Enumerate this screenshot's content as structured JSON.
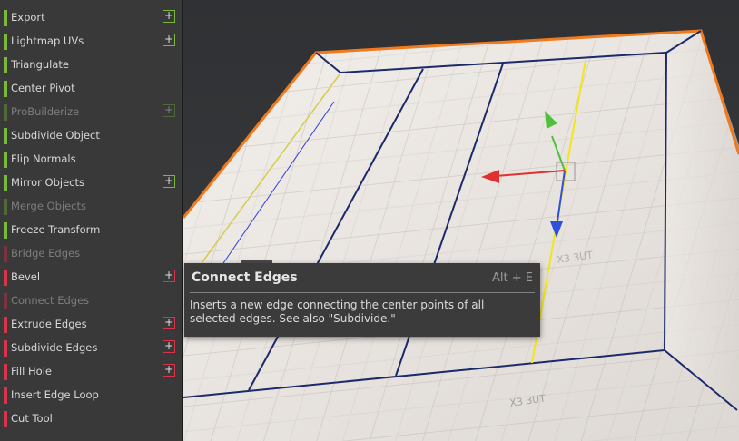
{
  "menu": {
    "items": [
      {
        "label": "Export",
        "category": "object",
        "enabled": true,
        "has_options": true
      },
      {
        "label": "Lightmap UVs",
        "category": "object",
        "enabled": true,
        "has_options": true
      },
      {
        "label": "Triangulate",
        "category": "object",
        "enabled": true,
        "has_options": false
      },
      {
        "label": "Center Pivot",
        "category": "object",
        "enabled": true,
        "has_options": false
      },
      {
        "label": "ProBuilderize",
        "category": "object",
        "enabled": false,
        "has_options": true
      },
      {
        "label": "Subdivide Object",
        "category": "object",
        "enabled": true,
        "has_options": false
      },
      {
        "label": "Flip Normals",
        "category": "object",
        "enabled": true,
        "has_options": false
      },
      {
        "label": "Mirror Objects",
        "category": "object",
        "enabled": true,
        "has_options": true
      },
      {
        "label": "Merge Objects",
        "category": "object",
        "enabled": false,
        "has_options": false
      },
      {
        "label": "Freeze Transform",
        "category": "object",
        "enabled": true,
        "has_options": false
      },
      {
        "label": "Bridge Edges",
        "category": "edge",
        "enabled": false,
        "has_options": false
      },
      {
        "label": "Bevel",
        "category": "edge",
        "enabled": true,
        "has_options": true
      },
      {
        "label": "Connect Edges",
        "category": "edge",
        "enabled": false,
        "has_options": false
      },
      {
        "label": "Extrude Edges",
        "category": "edge",
        "enabled": true,
        "has_options": true
      },
      {
        "label": "Subdivide Edges",
        "category": "edge",
        "enabled": true,
        "has_options": true
      },
      {
        "label": "Fill Hole",
        "category": "edge",
        "enabled": true,
        "has_options": true
      },
      {
        "label": "Insert Edge Loop",
        "category": "edge",
        "enabled": true,
        "has_options": false
      },
      {
        "label": "Cut Tool",
        "category": "edge",
        "enabled": true,
        "has_options": false
      }
    ],
    "options_symbol": "+",
    "colors": {
      "object": "#79b93a",
      "object_disabled": "#4f6a37",
      "edge": "#d9334a",
      "edge_disabled": "#7a3340"
    }
  },
  "tooltip": {
    "title": "Connect Edges",
    "shortcut": "Alt + E",
    "description": "Inserts a new edge connecting the center points of all selected edges.  See also \"Subdivide.\""
  },
  "viewport": {
    "grid_label": "X3 3UT",
    "gizmo_icons": [
      "y-axis-arrow-icon",
      "x-axis-arrow-icon",
      "z-axis-arrow-icon"
    ],
    "colors": {
      "selection_outline": "#f07a1e",
      "x_axis": "#e03030",
      "y_axis": "#4fc23c",
      "z_axis": "#2f4fe0",
      "selected_edge": "#f2e618"
    }
  }
}
